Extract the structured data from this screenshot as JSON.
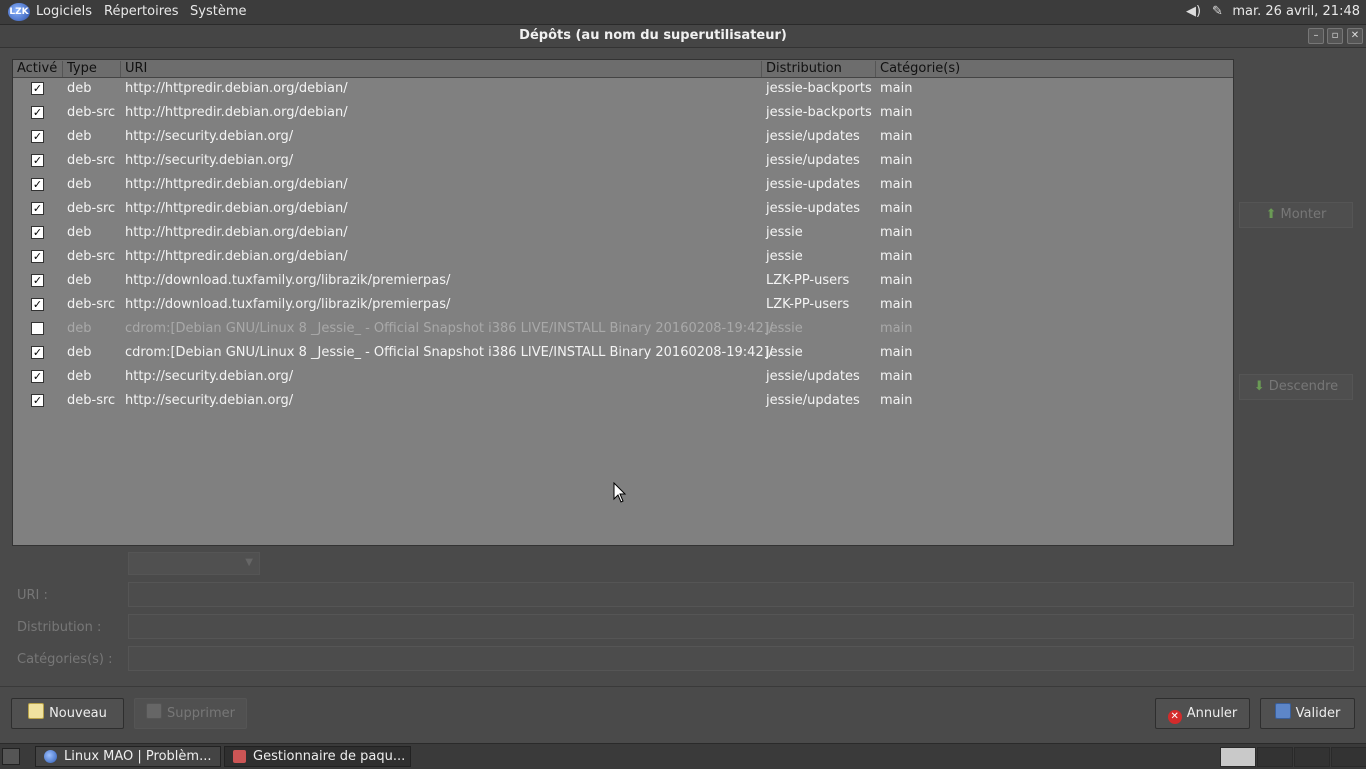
{
  "top_panel": {
    "logo_text": "LZK",
    "menu": [
      "Logiciels",
      "Répertoires",
      "Système"
    ],
    "clock": "mar. 26 avril, 21:48"
  },
  "window": {
    "title": "Dépôts (au nom du superutilisateur)"
  },
  "table": {
    "columns": [
      "Activé",
      "Type",
      "URI",
      "Distribution",
      "Catégorie(s)"
    ],
    "rows": [
      {
        "enabled": true,
        "type": "deb",
        "uri": "http://httpredir.debian.org/debian/",
        "distribution": "jessie-backports",
        "categories": "main"
      },
      {
        "enabled": true,
        "type": "deb-src",
        "uri": "http://httpredir.debian.org/debian/",
        "distribution": "jessie-backports",
        "categories": "main"
      },
      {
        "enabled": true,
        "type": "deb",
        "uri": "http://security.debian.org/",
        "distribution": "jessie/updates",
        "categories": "main"
      },
      {
        "enabled": true,
        "type": "deb-src",
        "uri": "http://security.debian.org/",
        "distribution": "jessie/updates",
        "categories": "main"
      },
      {
        "enabled": true,
        "type": "deb",
        "uri": "http://httpredir.debian.org/debian/",
        "distribution": "jessie-updates",
        "categories": "main"
      },
      {
        "enabled": true,
        "type": "deb-src",
        "uri": "http://httpredir.debian.org/debian/",
        "distribution": "jessie-updates",
        "categories": "main"
      },
      {
        "enabled": true,
        "type": "deb",
        "uri": "http://httpredir.debian.org/debian/",
        "distribution": "jessie",
        "categories": "main"
      },
      {
        "enabled": true,
        "type": "deb-src",
        "uri": "http://httpredir.debian.org/debian/",
        "distribution": "jessie",
        "categories": "main"
      },
      {
        "enabled": true,
        "type": "deb",
        "uri": "http://download.tuxfamily.org/librazik/premierpas/",
        "distribution": "LZK-PP-users",
        "categories": "main"
      },
      {
        "enabled": true,
        "type": "deb-src",
        "uri": "http://download.tuxfamily.org/librazik/premierpas/",
        "distribution": "LZK-PP-users",
        "categories": "main"
      },
      {
        "enabled": false,
        "type": "deb",
        "uri": "cdrom:[Debian GNU/Linux 8 _Jessie_ - Official Snapshot i386 LIVE/INSTALL Binary 20160208-19:42]/",
        "distribution": "jessie",
        "categories": "main"
      },
      {
        "enabled": true,
        "type": "deb",
        "uri": "cdrom:[Debian GNU/Linux 8 _Jessie_ - Official Snapshot i386 LIVE/INSTALL Binary 20160208-19:42]/",
        "distribution": "jessie",
        "categories": "main"
      },
      {
        "enabled": true,
        "type": "deb",
        "uri": "http://security.debian.org/",
        "distribution": "jessie/updates",
        "categories": "main"
      },
      {
        "enabled": true,
        "type": "deb-src",
        "uri": "http://security.debian.org/",
        "distribution": "jessie/updates",
        "categories": "main"
      }
    ]
  },
  "side_buttons": {
    "up": "Monter",
    "down": "Descendre"
  },
  "editor": {
    "uri_label": "URI :",
    "distribution_label": "Distribution :",
    "categories_label": "Catégories(s) :",
    "uri_value": "",
    "distribution_value": "",
    "categories_value": ""
  },
  "buttons": {
    "new": "Nouveau",
    "delete": "Supprimer",
    "cancel": "Annuler",
    "ok": "Valider"
  },
  "taskbar": {
    "tasks": [
      "Linux MAO | Problèm...",
      "Gestionnaire de paqu..."
    ]
  }
}
